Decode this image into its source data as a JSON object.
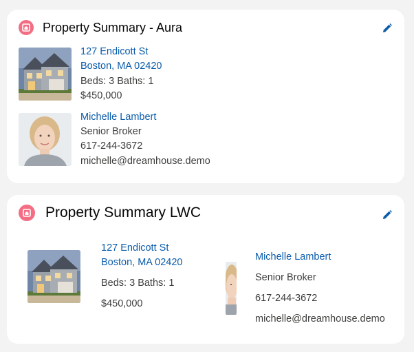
{
  "aura_card": {
    "title": "Property Summary - Aura",
    "header_icon": "home-icon",
    "edit_icon": "edit-pencil-icon",
    "property": {
      "street": "127 Endicott St",
      "city_line": "Boston, MA 02420",
      "beds_baths": "Beds: 3 Baths: 1",
      "price": "$450,000"
    },
    "broker": {
      "name": "Michelle Lambert",
      "title": "Senior Broker",
      "phone": "617-244-3672",
      "email": "michelle@dreamhouse.demo"
    }
  },
  "lwc_card": {
    "title": "Property Summary LWC",
    "header_icon": "home-icon",
    "edit_icon": "edit-pencil-icon",
    "property": {
      "street": "127 Endicott St",
      "city_line": "Boston, MA 02420",
      "beds_baths": "Beds: 3 Baths: 1",
      "price": "$450,000"
    },
    "broker": {
      "name": "Michelle Lambert",
      "title": "Senior Broker",
      "phone": "617-244-3672",
      "email": "michelle@dreamhouse.demo"
    }
  },
  "colors": {
    "page_background": "#f3f3f3",
    "card_background": "#ffffff",
    "link": "#0b5cab",
    "header_icon": "#f36e83",
    "edit_icon": "#0b5cab"
  }
}
